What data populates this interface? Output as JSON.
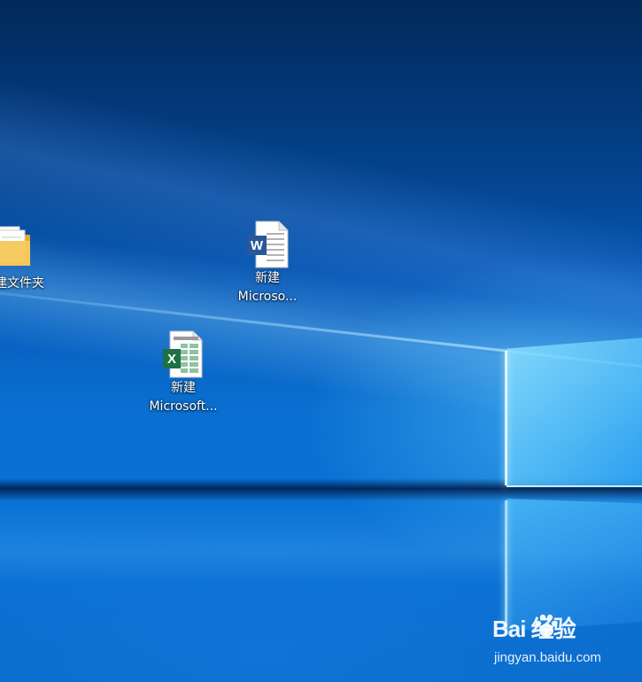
{
  "desktop": {
    "icons": [
      {
        "label": "建文件夹",
        "type": "folder-icon"
      },
      {
        "label_line1": "新建",
        "label_line2": "Microso...",
        "type": "word-document-icon"
      },
      {
        "label_line1": "新建",
        "label_line2": "Microsoft...",
        "type": "excel-document-icon"
      }
    ]
  },
  "watermark": {
    "logo_text": "Bai  经验",
    "url": "jingyan.baidu.com"
  },
  "colors": {
    "wallpaper_dark": "#02295a",
    "wallpaper_mid": "#0658b6",
    "wallpaper_light": "#0a73d6",
    "word_blue": "#2b579a",
    "excel_green": "#1e7145",
    "folder_yellow": "#f5c85a"
  }
}
